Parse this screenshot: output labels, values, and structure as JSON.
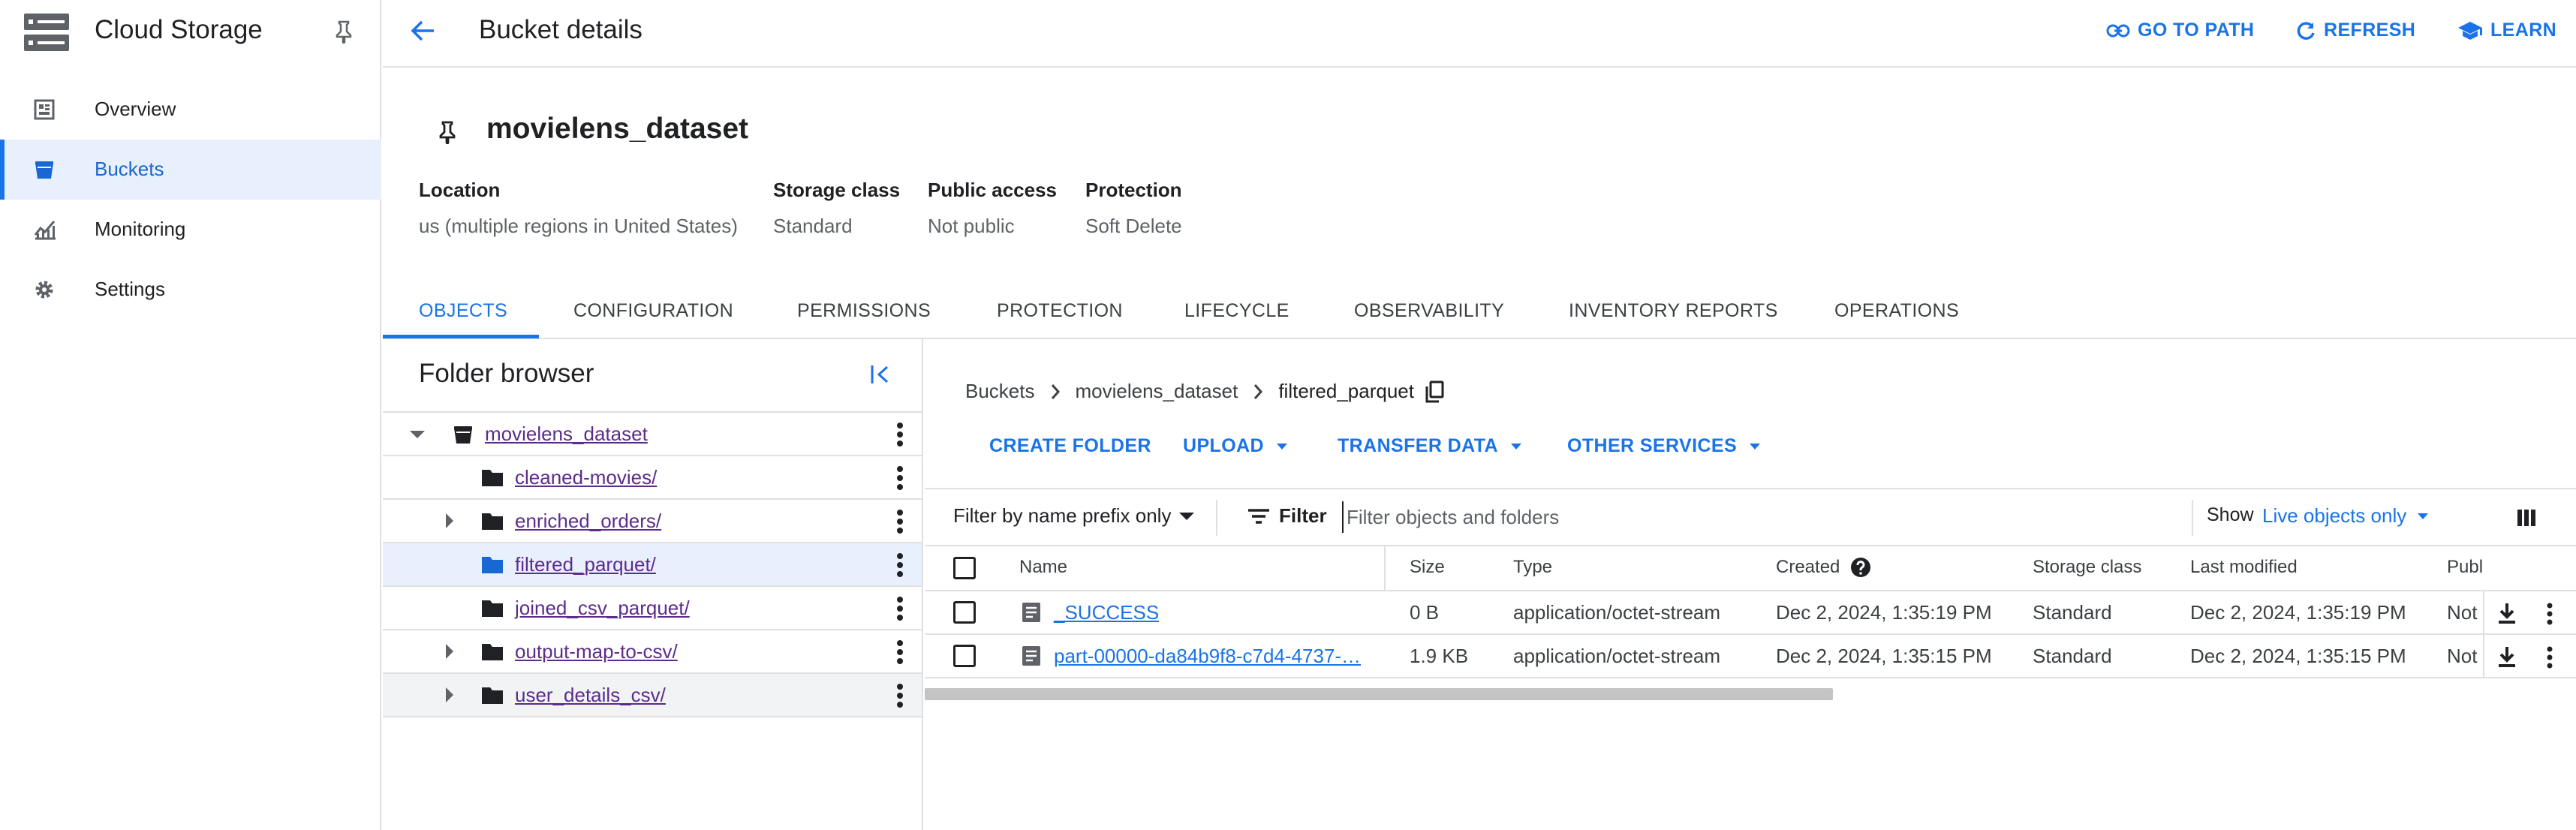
{
  "app": {
    "title": "Cloud Storage",
    "icons": {
      "logo": "storage-logo-icon",
      "pin": "pin-icon"
    }
  },
  "nav": {
    "items": [
      {
        "label": "Overview",
        "icon": "dashboard-icon",
        "active": false
      },
      {
        "label": "Buckets",
        "icon": "bucket-icon",
        "active": true
      },
      {
        "label": "Monitoring",
        "icon": "monitoring-chart-icon",
        "active": false
      },
      {
        "label": "Settings",
        "icon": "gear-icon",
        "active": false
      }
    ]
  },
  "header": {
    "title": "Bucket details",
    "actions": {
      "go_to_path": "GO TO PATH",
      "refresh": "REFRESH",
      "learn": "LEARN"
    }
  },
  "bucket": {
    "name": "movielens_dataset",
    "meta": {
      "location_label": "Location",
      "location_value": "us (multiple regions in United States)",
      "storage_class_label": "Storage class",
      "storage_class_value": "Standard",
      "public_access_label": "Public access",
      "public_access_value": "Not public",
      "protection_label": "Protection",
      "protection_value": "Soft Delete"
    }
  },
  "tabs": [
    {
      "label": "OBJECTS",
      "active": true
    },
    {
      "label": "CONFIGURATION",
      "active": false
    },
    {
      "label": "PERMISSIONS",
      "active": false
    },
    {
      "label": "PROTECTION",
      "active": false
    },
    {
      "label": "LIFECYCLE",
      "active": false
    },
    {
      "label": "OBSERVABILITY",
      "active": false
    },
    {
      "label": "INVENTORY REPORTS",
      "active": false
    },
    {
      "label": "OPERATIONS",
      "active": false
    }
  ],
  "folder_browser": {
    "title": "Folder browser",
    "root": "movielens_dataset",
    "folders": [
      {
        "name": "cleaned-movies/",
        "expandable": false,
        "selected": false
      },
      {
        "name": "enriched_orders/",
        "expandable": true,
        "selected": false
      },
      {
        "name": "filtered_parquet/",
        "expandable": false,
        "selected": true
      },
      {
        "name": "joined_csv_parquet/",
        "expandable": false,
        "selected": false
      },
      {
        "name": "output-map-to-csv/",
        "expandable": true,
        "selected": false
      },
      {
        "name": "user_details_csv/",
        "expandable": true,
        "selected": false
      }
    ]
  },
  "breadcrumbs": {
    "items": [
      "Buckets",
      "movielens_dataset",
      "filtered_parquet"
    ]
  },
  "object_actions": {
    "create_folder": "CREATE FOLDER",
    "upload": "UPLOAD",
    "transfer_data": "TRANSFER DATA",
    "other_services": "OTHER SERVICES"
  },
  "filter": {
    "prefix_mode": "Filter by name prefix only",
    "filter_label": "Filter",
    "placeholder": "Filter objects and folders",
    "value": "",
    "show_label": "Show",
    "show_value": "Live objects only"
  },
  "table": {
    "columns": [
      "Name",
      "Size",
      "Type",
      "Created",
      "Storage class",
      "Last modified",
      "Publ"
    ],
    "rows": [
      {
        "name": "_SUCCESS",
        "size": "0 B",
        "type": "application/octet-stream",
        "created": "Dec 2, 2024, 1:35:19 PM",
        "storage_class": "Standard",
        "last_modified": "Dec 2, 2024, 1:35:19 PM",
        "public": "Not"
      },
      {
        "name": "part-00000-da84b9f8-c7d4-4737-…",
        "size": "1.9 KB",
        "type": "application/octet-stream",
        "created": "Dec 2, 2024, 1:35:15 PM",
        "storage_class": "Standard",
        "last_modified": "Dec 2, 2024, 1:35:15 PM",
        "public": "Not"
      }
    ]
  },
  "colors": {
    "accent": "#1a73e8",
    "visited_link": "#5b2c8c",
    "selected_bg": "#e8f0fe"
  }
}
